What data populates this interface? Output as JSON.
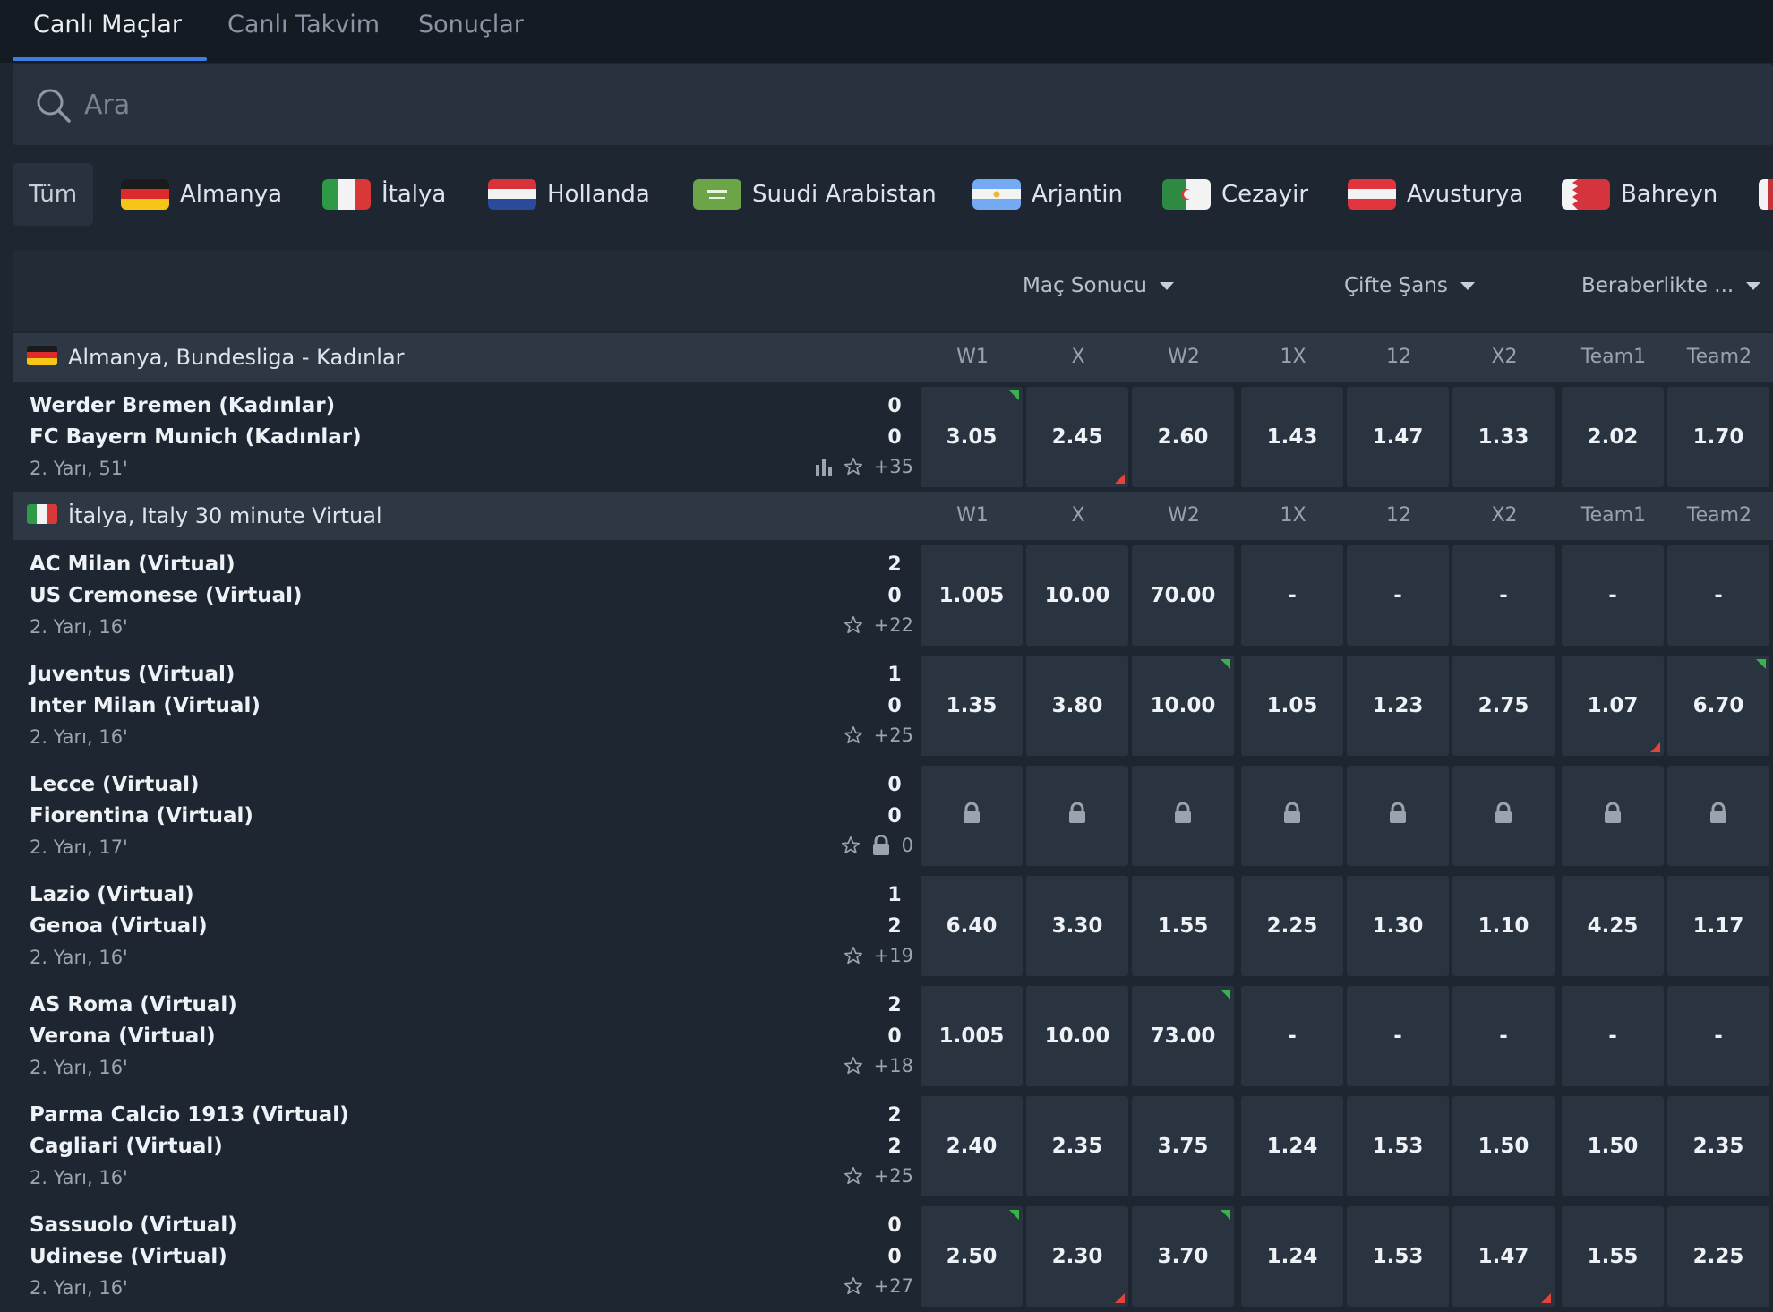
{
  "tabs": [
    {
      "label": "Canlı Maçlar",
      "active": true
    },
    {
      "label": "Canlı Takvim",
      "active": false
    },
    {
      "label": "Sonuçlar",
      "active": false
    }
  ],
  "search": {
    "placeholder": "Ara",
    "icon": "search-icon"
  },
  "filters": {
    "all_label": "Tüm",
    "countries": [
      "Almanya",
      "İtalya",
      "Hollanda",
      "Suudi Arabistan",
      "Arjantin",
      "Cezayir",
      "Avusturya",
      "Bahreyn"
    ]
  },
  "markets": [
    {
      "label": "Maç Sonucu"
    },
    {
      "label": "Çifte Şans"
    },
    {
      "label": "Beraberlikte ..."
    }
  ],
  "columns": [
    "W1",
    "X",
    "W2",
    "1X",
    "12",
    "X2",
    "Team1",
    "Team2"
  ],
  "leagues": [
    {
      "name": "Almanya, Bundesliga - Kadınlar",
      "matches": [
        {
          "home": "Werder Bremen (Kadınlar)",
          "away": "FC Bayern Munich (Kadınlar)",
          "home_score": "0",
          "away_score": "0",
          "time": "2. Yarı, 51'",
          "more": "+35",
          "has_stats": true,
          "locked": false,
          "odds": [
            "3.05",
            "2.45",
            "2.60",
            "1.43",
            "1.47",
            "1.33",
            "2.02",
            "1.70"
          ],
          "trend": [
            "up",
            "down",
            "",
            "",
            "",
            "",
            "",
            ""
          ]
        }
      ]
    },
    {
      "name": "İtalya, Italy 30 minute Virtual",
      "matches": [
        {
          "home": "AC Milan (Virtual)",
          "away": "US Cremonese (Virtual)",
          "home_score": "2",
          "away_score": "0",
          "time": "2. Yarı, 16'",
          "more": "+22",
          "has_stats": false,
          "locked": false,
          "odds": [
            "1.005",
            "10.00",
            "70.00",
            "-",
            "-",
            "-",
            "-",
            "-"
          ],
          "trend": [
            "",
            "",
            "",
            "",
            "",
            "",
            "",
            ""
          ]
        },
        {
          "home": "Juventus (Virtual)",
          "away": "Inter Milan (Virtual)",
          "home_score": "1",
          "away_score": "0",
          "time": "2. Yarı, 16'",
          "more": "+25",
          "has_stats": false,
          "locked": false,
          "odds": [
            "1.35",
            "3.80",
            "10.00",
            "1.05",
            "1.23",
            "2.75",
            "1.07",
            "6.70"
          ],
          "trend": [
            "",
            "",
            "up",
            "",
            "",
            "",
            "down",
            "up"
          ]
        },
        {
          "home": "Lecce (Virtual)",
          "away": "Fiorentina (Virtual)",
          "home_score": "0",
          "away_score": "0",
          "time": "2. Yarı, 17'",
          "more": "0",
          "has_stats": false,
          "locked": true,
          "odds": [
            "",
            "",
            "",
            "",
            "",
            "",
            "",
            ""
          ],
          "trend": [
            "",
            "",
            "",
            "",
            "",
            "",
            "",
            ""
          ]
        },
        {
          "home": "Lazio (Virtual)",
          "away": "Genoa (Virtual)",
          "home_score": "1",
          "away_score": "2",
          "time": "2. Yarı, 16'",
          "more": "+19",
          "has_stats": false,
          "locked": false,
          "odds": [
            "6.40",
            "3.30",
            "1.55",
            "2.25",
            "1.30",
            "1.10",
            "4.25",
            "1.17"
          ],
          "trend": [
            "",
            "",
            "",
            "",
            "",
            "",
            "",
            ""
          ]
        },
        {
          "home": "AS Roma (Virtual)",
          "away": "Verona (Virtual)",
          "home_score": "2",
          "away_score": "0",
          "time": "2. Yarı, 16'",
          "more": "+18",
          "has_stats": false,
          "locked": false,
          "odds": [
            "1.005",
            "10.00",
            "73.00",
            "-",
            "-",
            "-",
            "-",
            "-"
          ],
          "trend": [
            "",
            "",
            "up",
            "",
            "",
            "",
            "",
            ""
          ]
        },
        {
          "home": "Parma Calcio 1913 (Virtual)",
          "away": "Cagliari (Virtual)",
          "home_score": "2",
          "away_score": "2",
          "time": "2. Yarı, 16'",
          "more": "+25",
          "has_stats": false,
          "locked": false,
          "odds": [
            "2.40",
            "2.35",
            "3.75",
            "1.24",
            "1.53",
            "1.50",
            "1.50",
            "2.35"
          ],
          "trend": [
            "",
            "",
            "",
            "",
            "",
            "",
            "",
            ""
          ]
        },
        {
          "home": "Sassuolo (Virtual)",
          "away": "Udinese (Virtual)",
          "home_score": "0",
          "away_score": "0",
          "time": "2. Yarı, 16'",
          "more": "+27",
          "has_stats": false,
          "locked": false,
          "odds": [
            "2.50",
            "2.30",
            "3.70",
            "1.24",
            "1.53",
            "1.47",
            "1.55",
            "2.25"
          ],
          "trend": [
            "up",
            "down",
            "up",
            "",
            "",
            "down",
            "",
            ""
          ]
        }
      ]
    }
  ],
  "colors": {
    "background": "#1d2631",
    "topbar": "#141b23",
    "accent": "#3d7ee6",
    "odd_cell": "#2a3440",
    "league_row": "#2d3844",
    "trend_up": "#38b24a",
    "trend_down": "#e2433b"
  }
}
